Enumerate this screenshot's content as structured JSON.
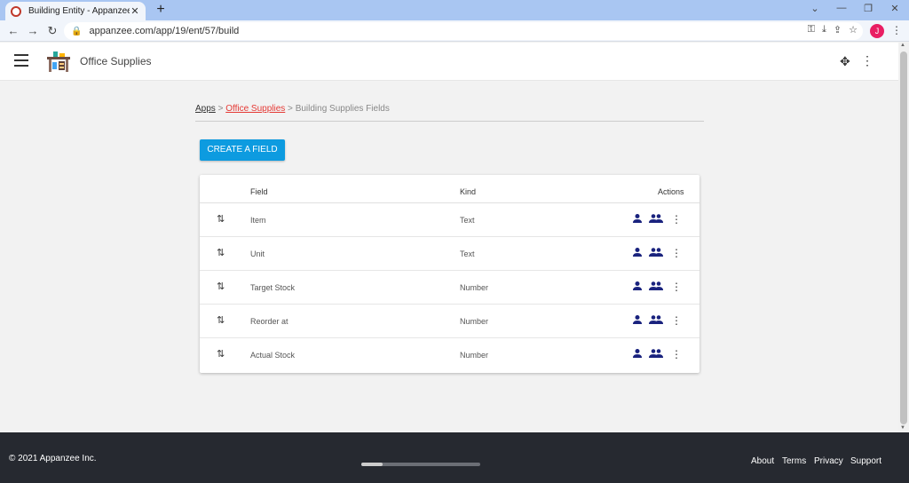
{
  "browser": {
    "tab_title": "Building Entity - Appanzee",
    "tab_close": "✕",
    "new_tab": "+",
    "url": "appanzee.com/app/19/ent/57/build",
    "profile_initial": "J"
  },
  "header": {
    "app_name": "Office Supplies"
  },
  "breadcrumb": {
    "apps": "Apps",
    "sep1": " > ",
    "office_supplies": "Office Supplies",
    "sep2": " > ",
    "current": "Building Supplies Fields"
  },
  "create_button": "CREATE A FIELD",
  "table": {
    "columns": {
      "field": "Field",
      "kind": "Kind",
      "actions": "Actions"
    },
    "rows": [
      {
        "field": "Item",
        "kind": "Text"
      },
      {
        "field": "Unit",
        "kind": "Text"
      },
      {
        "field": "Target Stock",
        "kind": "Number"
      },
      {
        "field": "Reorder at",
        "kind": "Number"
      },
      {
        "field": "Actual Stock",
        "kind": "Number"
      }
    ]
  },
  "footer": {
    "copyright": "© 2021 Appanzee Inc.",
    "links": [
      "About",
      "Terms",
      "Privacy",
      "Support"
    ]
  },
  "colors": {
    "accent": "#0d9be0",
    "breadcrumb_active": "#e53935",
    "action_icon": "#1a237e",
    "footer_bg": "#262930"
  },
  "icons": {
    "sort": "swap-vert-icon",
    "user": "person-icon",
    "group": "group-icon",
    "more": "more-vert-icon",
    "menu": "hamburger-menu-icon",
    "game": "gamepad-icon"
  }
}
